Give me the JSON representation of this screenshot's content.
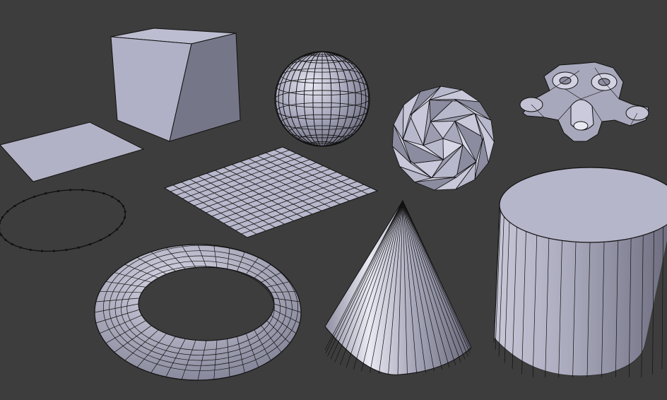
{
  "viewport": {
    "background": "#3d3d3d",
    "objects": [
      {
        "name": "cube"
      },
      {
        "name": "plane"
      },
      {
        "name": "circle"
      },
      {
        "name": "grid"
      },
      {
        "name": "uv-sphere"
      },
      {
        "name": "icosphere"
      },
      {
        "name": "monkey"
      },
      {
        "name": "torus"
      },
      {
        "name": "cone"
      },
      {
        "name": "cylinder"
      }
    ],
    "colors": {
      "face_light": "#c4c4d8",
      "face_mid": "#a3a3b8",
      "face_dark": "#7b7b8f",
      "edge": "#111111"
    }
  }
}
